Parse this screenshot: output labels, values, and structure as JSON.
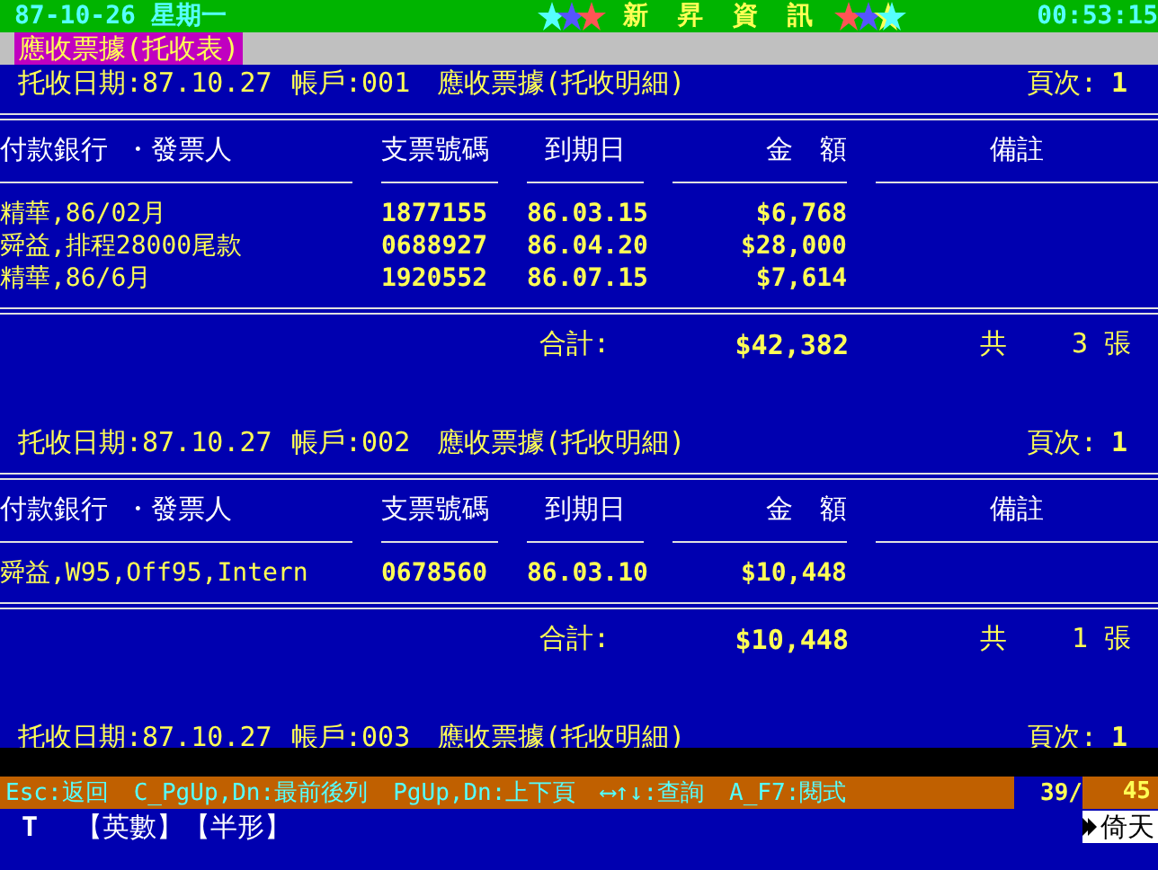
{
  "top_bar": {
    "date": "87-10-26 星期一",
    "title": "新 昇 資 訊",
    "time": "00:53:15"
  },
  "screen_title": "應收票據(托收表)",
  "sections": [
    {
      "header": {
        "date": "托收日期:87.10.27",
        "account": "帳戶:001",
        "report": "應收票據(托收明細)",
        "page_label": "頁次:",
        "page": "1"
      },
      "columns": [
        "付款銀行 ・發票人",
        "支票號碼",
        "到期日",
        "金　額",
        "備註"
      ],
      "rows": [
        {
          "payee": "精華,86/02月",
          "check_no": "1877155",
          "due": "86.03.15",
          "amount": "$6,768"
        },
        {
          "payee": "舜益,排程28000尾款",
          "check_no": "0688927",
          "due": "86.04.20",
          "amount": "$28,000"
        },
        {
          "payee": "精華,86/6月",
          "check_no": "1920552",
          "due": "86.07.15",
          "amount": "$7,614"
        }
      ],
      "total": {
        "label": "合計:",
        "amount": "$42,382",
        "count_label": "共",
        "count": "3 張"
      }
    },
    {
      "header": {
        "date": "托收日期:87.10.27",
        "account": "帳戶:002",
        "report": "應收票據(托收明細)",
        "page_label": "頁次:",
        "page": "1"
      },
      "columns": [
        "付款銀行 ・發票人",
        "支票號碼",
        "到期日",
        "金　額",
        "備註"
      ],
      "rows": [
        {
          "payee": "舜益,W95,Off95,Intern",
          "check_no": "0678560",
          "due": "86.03.10",
          "amount": "$10,448"
        }
      ],
      "total": {
        "label": "合計:",
        "amount": "$10,448",
        "count_label": "共",
        "count": "1 張"
      }
    },
    {
      "header": {
        "date": "托收日期:87.10.27",
        "account": "帳戶:003",
        "report": "應收票據(托收明細)",
        "page_label": "頁次:",
        "page": "1"
      }
    }
  ],
  "function_bar": {
    "keys": [
      "Esc:返回",
      "C_PgUp,Dn:最前後列",
      "PgUp,Dn:上下頁",
      "⟷↑↓:查詢",
      "A_F7:閱式"
    ],
    "position": "39/",
    "total": "45"
  },
  "status_line": {
    "mode": "T",
    "input_modes": [
      "【英數】",
      "【半形】"
    ],
    "ime": "倚天"
  }
}
